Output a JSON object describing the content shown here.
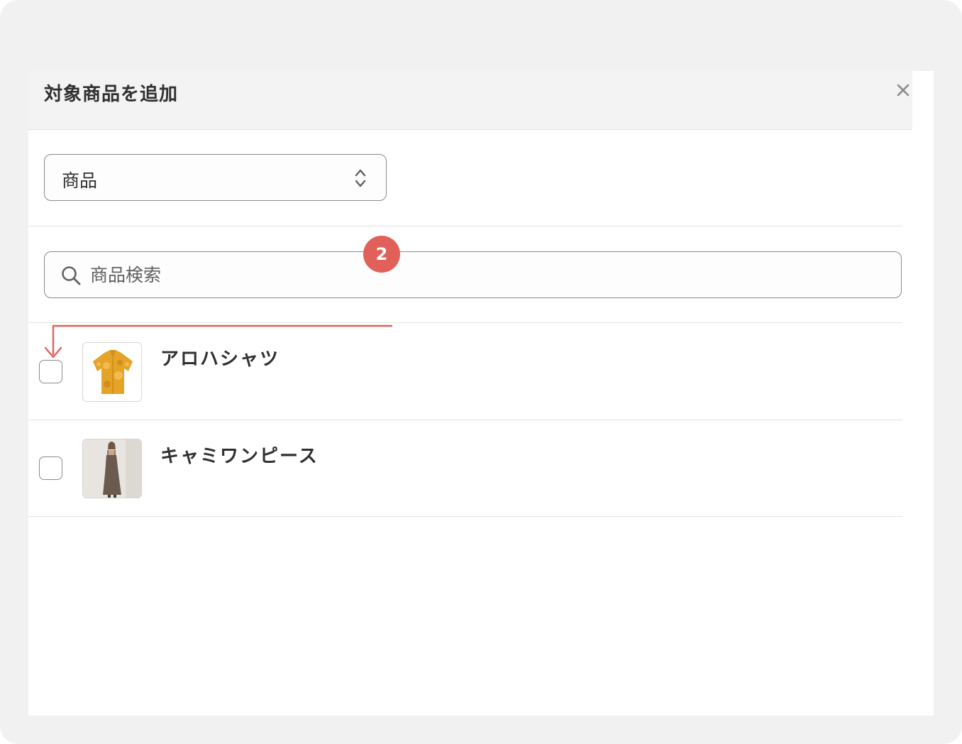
{
  "modal": {
    "title": "対象商品を追加",
    "close_icon": "close-icon"
  },
  "filter": {
    "selected_value": "商品",
    "chevron_icon": "select-chevron-icon"
  },
  "search": {
    "placeholder": "商品検索",
    "value": "",
    "icon": "search-icon"
  },
  "products": [
    {
      "name": "アロハシャツ",
      "checked": false,
      "thumbnail": "orange-aloha-shirt-image"
    },
    {
      "name": "キャミワンピース",
      "checked": false,
      "thumbnail": "brown-cami-dress-image"
    }
  ],
  "annotation": {
    "step_number": "2",
    "color": "#e2605a"
  },
  "colors": {
    "frame_background": "#f1f1f1",
    "header_background": "#f3f3f3",
    "border": "#8a8a8a",
    "text": "#303030"
  }
}
